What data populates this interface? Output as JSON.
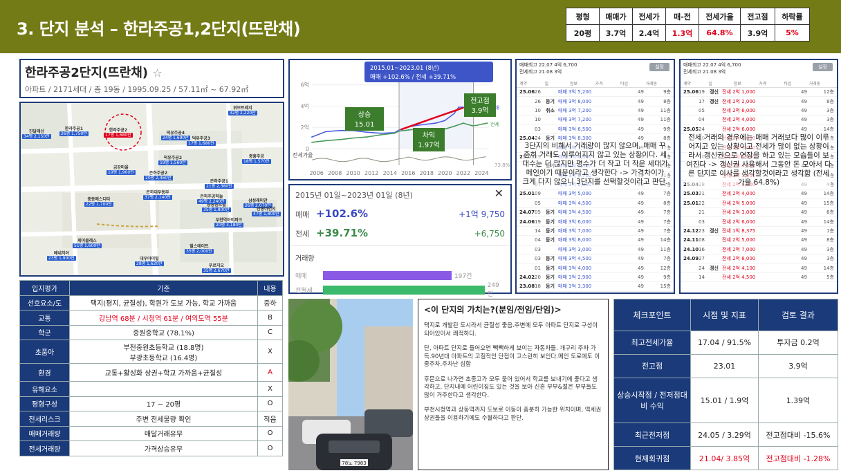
{
  "header": {
    "title": "3. 단지 분석 – 한라주공1,2단지(뜨란채)",
    "summary_headers": [
      "평형",
      "매매가",
      "전세가",
      "매-전",
      "전세가율",
      "전고점",
      "하락률"
    ],
    "summary_values": [
      "20평",
      "3.7억",
      "2.4억",
      "1.3억",
      "64.8%",
      "3.9억",
      "5%"
    ]
  },
  "complex": {
    "name": "한라주공2단지(뜨란채)",
    "star": "☆",
    "meta": "아파트 / 2171세대 / 총 19동 / 1995.09.25 / 57.11㎡ ~ 67.92㎡"
  },
  "map": {
    "labels": [
      {
        "name": "한라주공1",
        "sub": "26평 1,750만"
      },
      {
        "name": "한라주공2",
        "sub": "17평 1,680만"
      },
      {
        "name": "덕유주공4",
        "sub": "24평 1,690만"
      },
      {
        "name": "덕유주공3",
        "sub": "17평 1,680만"
      },
      {
        "name": "덕유주공2",
        "sub": "19평 1,560만"
      },
      {
        "name": "금강마을",
        "sub": "19평 1,900만"
      },
      {
        "name": "은하주공2",
        "sub": "20평 2,460만"
      },
      {
        "name": "은하주공1",
        "sub": "21평 2,380만"
      },
      {
        "name": "중동센트럴",
        "sub": "35평 1,800만"
      },
      {
        "name": "은하대우동부",
        "sub": "37평 2,140만"
      },
      {
        "name": "은하주공하늘",
        "sub": "49평 2,240만"
      },
      {
        "name": "중동에스디타",
        "sub": "22평 1,700만"
      },
      {
        "name": "진달래선",
        "sub": "34평 2,150만"
      },
      {
        "name": "위브트레지",
        "sub": "32평 2,220만"
      },
      {
        "name": "부천역아이파크",
        "sub": "20평 3,180만"
      },
      {
        "name": "삼성래미안",
        "sub": "26평 2,070만"
      },
      {
        "name": "제이클레스",
        "sub": "51평 1,600만"
      },
      {
        "name": "베네치아",
        "sub": "23평 1,900만"
      },
      {
        "name": "대우아이빌",
        "sub": "28평 1,620만"
      },
      {
        "name": "힐스테이트",
        "sub": "35평 2,000만"
      },
      {
        "name": "푸르지오",
        "sub": "35평 2,670만"
      },
      {
        "name": "산동아연서",
        "sub": "47평 1,800만"
      },
      {
        "name": "중흥주공",
        "sub": "18평 1,570만"
      }
    ]
  },
  "eval": {
    "headers": [
      "입지평가",
      "기준",
      "내용"
    ],
    "rows": [
      {
        "k": "선호요소/도",
        "v": "택지(평지, 균질성), 학원가 도보 가능, 학교 가까움",
        "r": "중하"
      },
      {
        "k": "교통",
        "v": "강남역 68분 / 시청역 61분 / 여의도역 55분",
        "r": "B"
      },
      {
        "k": "학군",
        "v": "중원중학교 (78.1%)",
        "r": "C"
      },
      {
        "k": "초품아",
        "v": "부천중원초등학교 (18.8명)",
        "v2": "부광초등학교 (16.4명)",
        "r": "X"
      },
      {
        "k": "환경",
        "v": "교통+활성화 상권+학교 가까움+균질성",
        "r": "A"
      },
      {
        "k": "유해요소",
        "v": "",
        "r": "X"
      },
      {
        "k": "평형구성",
        "v": "17 ~ 20평",
        "r": "O"
      },
      {
        "k": "전세리스크",
        "v": "주변 전세물량 확인",
        "r": "적음"
      },
      {
        "k": "매매거래량",
        "v": "매달거래유무",
        "r": "O"
      },
      {
        "k": "전세거래량",
        "v": "가격상승유무",
        "r": "O"
      }
    ]
  },
  "chart_data": {
    "type": "line",
    "title": "2015.01~2023.01 (8년)",
    "subtitle": "매매 +102.6% / 전세 +39.71%",
    "x_ticks": [
      "2006",
      "2008",
      "2010",
      "2012",
      "2014",
      "2016",
      "2018",
      "2020",
      "2022",
      "2024"
    ],
    "y_ticks": [
      "0",
      "2억",
      "4억",
      "6억"
    ],
    "ylim": [
      0,
      6.5
    ],
    "series": [
      {
        "name": "매매",
        "x": [
          2005.5,
          2007,
          2008.5,
          2010,
          2011.5,
          2013,
          2014.5,
          2015,
          2016,
          2017,
          2018,
          2019,
          2020,
          2021,
          2021.5,
          2022,
          2022.5,
          2023,
          2023.5,
          2024,
          2024.6
        ],
        "values": [
          1.1,
          1.6,
          1.7,
          1.7,
          1.55,
          1.45,
          1.5,
          1.75,
          2.05,
          2.2,
          2.3,
          2.4,
          2.65,
          3.3,
          3.9,
          3.9,
          3.55,
          3.3,
          3.4,
          3.5,
          3.7
        ],
        "color": "#4a5fe0"
      },
      {
        "name": "전세",
        "x": [
          2005.5,
          2007,
          2008.5,
          2010,
          2011.5,
          2013,
          2014.5,
          2015,
          2016,
          2017,
          2018,
          2019,
          2020,
          2021,
          2022,
          2023,
          2023.5,
          2024,
          2024.6
        ],
        "values": [
          0.6,
          0.75,
          0.85,
          1.0,
          1.1,
          1.3,
          1.45,
          1.65,
          1.75,
          1.85,
          1.8,
          1.75,
          1.85,
          2.1,
          2.4,
          2.15,
          2.2,
          2.3,
          2.4
        ],
        "color": "#4a9a5a"
      }
    ],
    "ratio_label": "전세가율",
    "ratio_value": "73.8%",
    "legend_deal": "매매",
    "legend_rent": "전세",
    "annotations": [
      {
        "text": "상승",
        "sub": "15.01"
      },
      {
        "text": "차익",
        "sub": "1.97억"
      },
      {
        "text": "전고점",
        "sub": "3.9억"
      }
    ]
  },
  "stats": {
    "date": "2015년 01일~2023년 01일 (8년)",
    "close": "✕",
    "deal_label": "매매",
    "deal_pct": "+102.6%",
    "deal_amt": "+1억 9,750",
    "rent_label": "전세",
    "rent_pct": "+39.71%",
    "rent_amt": "+6,750",
    "volume_label": "거래량",
    "vol_deal_label": "매매",
    "vol_deal_value": "197건",
    "vol_deal_count": 197,
    "vol_rent_label": "전월세",
    "vol_rent_value": "249건",
    "vol_rent_count": 249
  },
  "listing_a": {
    "line1": "매매최고 22.07 4억 6,700",
    "line2": "전세최고 21.08 3억",
    "badge": "설정",
    "cols": [
      "계약",
      "일",
      "정보",
      "가격",
      "타입",
      "거래동"
    ],
    "rows": [
      {
        "d": "25.06",
        "f": "26",
        "t": "",
        "p": "매매 3억 5,200",
        "s": "49",
        "n": "9층"
      },
      {
        "d": "",
        "f": "26",
        "t": "등기",
        "p": "매매 3억 8,000",
        "s": "49",
        "n": "8층"
      },
      {
        "d": "",
        "f": "10",
        "t": "취소",
        "p": "매매 3억 7,200",
        "s": "49",
        "n": "11층"
      },
      {
        "d": "",
        "f": "10",
        "t": "",
        "p": "매매 3억 7,200",
        "s": "49",
        "n": "11층"
      },
      {
        "d": "",
        "f": "03",
        "t": "",
        "p": "매매 3억 6,500",
        "s": "49",
        "n": "9층"
      },
      {
        "d": "25.04",
        "f": "24",
        "t": "등기",
        "p": "매매 3억 8,300",
        "s": "49",
        "n": "8층"
      },
      {
        "d": "",
        "f": "17",
        "t": "",
        "p": "매매 3억 7,500",
        "s": "49",
        "n": "7층"
      },
      {
        "d": "25.03",
        "f": "29",
        "t": "",
        "p": "매매 3억 8,800",
        "s": "49",
        "n": "9층"
      },
      {
        "d": "",
        "f": "22",
        "t": "등기",
        "p": "매매 3억 7,800",
        "s": "49",
        "n": "11층"
      },
      {
        "d": "",
        "f": "14",
        "t": "",
        "p": "매매 3억 6,700",
        "s": "49",
        "n": "11층"
      },
      {
        "d": "",
        "f": "07",
        "t": "",
        "p": "매매 3억 6,000",
        "s": "49",
        "n": "10층"
      },
      {
        "d": "25.01",
        "f": "09",
        "t": "",
        "p": "매매 3억 5,000",
        "s": "49",
        "n": "7층"
      },
      {
        "d": "",
        "f": "05",
        "t": "",
        "p": "매매 3억 4,500",
        "s": "49",
        "n": "8층"
      },
      {
        "d": "24.07",
        "f": "05",
        "t": "등기",
        "p": "매매 3억 4,500",
        "s": "49",
        "n": "7층"
      },
      {
        "d": "24.06",
        "f": "19",
        "t": "등기",
        "p": "매매 3억 6,000",
        "s": "49",
        "n": "7층"
      },
      {
        "d": "",
        "f": "14",
        "t": "등기",
        "p": "매매 3억 7,000",
        "s": "49",
        "n": "7층"
      },
      {
        "d": "",
        "f": "04",
        "t": "등기",
        "p": "매매 3억 8,000",
        "s": "49",
        "n": "14층"
      },
      {
        "d": "",
        "f": "03",
        "t": "",
        "p": "매매 3억 3,000",
        "s": "49",
        "n": "11층"
      },
      {
        "d": "",
        "f": "03",
        "t": "등기",
        "p": "매매 3억 4,500",
        "s": "49",
        "n": "7층"
      },
      {
        "d": "",
        "f": "01",
        "t": "등기",
        "p": "매매 3억 4,000",
        "s": "49",
        "n": "12층"
      },
      {
        "d": "24.02",
        "f": "20",
        "t": "등기",
        "p": "매매 3억 2,900",
        "s": "49",
        "n": "9층"
      },
      {
        "d": "23.08",
        "f": "18",
        "t": "등기",
        "p": "매매 3억 3,300",
        "s": "49",
        "n": "15층"
      }
    ],
    "overlay": "3단지의 비해서 거래량이 많지 않으며, 매매 꾸준히 거래도 이루어지지 않고 있는 상황이다. 세대수는 더 많지만 평수가 더 작고 더 작은 세대가 메인이기 때문이라고 생각한다 -> 가격차이가 크게 다지 않으니 3단지를 선택할것이라고 판단."
  },
  "listing_b": {
    "line1": "매매최고 22.07 4억 6,700",
    "line2": "전세최고 21.08 3억",
    "badge": "설정",
    "cols": [
      "계약",
      "일",
      "정보",
      "가격",
      "타입",
      "거래동"
    ],
    "rows": [
      {
        "d": "25.06",
        "f": "19",
        "t": "갱신",
        "p": "전세 2억 1,000",
        "s": "49",
        "n": "12층"
      },
      {
        "d": "",
        "f": "17",
        "t": "갱신",
        "p": "전세 2억 2,000",
        "s": "49",
        "n": "8층"
      },
      {
        "d": "",
        "f": "05",
        "t": "",
        "p": "전세 2억 6,000",
        "s": "49",
        "n": "3층"
      },
      {
        "d": "",
        "f": "04",
        "t": "",
        "p": "전세 2억 4,000",
        "s": "49",
        "n": "3층"
      },
      {
        "d": "25.05",
        "f": "24",
        "t": "",
        "p": "전세 2억 6,000",
        "s": "49",
        "n": "14층"
      },
      {
        "d": "",
        "f": "20",
        "t": "",
        "p": "전세 2억 5,000",
        "s": "49",
        "n": "2층"
      },
      {
        "d": "",
        "f": "13",
        "t": "",
        "p": "전세 2억 3,000",
        "s": "49",
        "n": "5층"
      },
      {
        "d": "",
        "f": "10",
        "t": "",
        "p": "전세 2억 6,000",
        "s": "49",
        "n": "11층"
      },
      {
        "d": "",
        "f": "07",
        "t": "",
        "p": "전세 2억 4,500",
        "s": "49",
        "n": "7층"
      },
      {
        "d": "",
        "f": "03",
        "t": "",
        "p": "전세 2억 5,000",
        "s": "49",
        "n": "9층"
      },
      {
        "d": "25.04",
        "f": "28",
        "t": "",
        "p": "전세 2억 6,000",
        "s": "49",
        "n": "4층"
      },
      {
        "d": "25.03",
        "f": "21",
        "t": "",
        "p": "전세 2억 4,000",
        "s": "49",
        "n": "14층"
      },
      {
        "d": "25.01",
        "f": "22",
        "t": "",
        "p": "전세 2억 5,000",
        "s": "49",
        "n": "15층"
      },
      {
        "d": "",
        "f": "21",
        "t": "",
        "p": "전세 2억 3,000",
        "s": "49",
        "n": "6층"
      },
      {
        "d": "",
        "f": "03",
        "t": "",
        "p": "전세 2억 6,000",
        "s": "49",
        "n": "14층"
      },
      {
        "d": "24.12",
        "f": "23",
        "t": "갱신",
        "p": "전세 1억 8,375",
        "s": "49",
        "n": "1층"
      },
      {
        "d": "24.11",
        "f": "08",
        "t": "",
        "p": "전세 2억 5,000",
        "s": "49",
        "n": "8층"
      },
      {
        "d": "24.10",
        "f": "16",
        "t": "",
        "p": "전세 2억 7,000",
        "s": "49",
        "n": "3층"
      },
      {
        "d": "24.09",
        "f": "27",
        "t": "",
        "p": "전세 2억 8,000",
        "s": "49",
        "n": "3층"
      },
      {
        "d": "",
        "f": "24",
        "t": "갱신",
        "p": "전세 2억 4,100",
        "s": "49",
        "n": "14층"
      },
      {
        "d": "",
        "f": "14",
        "t": "",
        "p": "전세 2억 4,500",
        "s": "49",
        "n": "5층"
      }
    ],
    "overlay": "전세 거래의 경우에는 매매 거래보다 많이 이루어지고 있는 상황이고 전세가 많이 없는 상황이라서 갱신권으로 연장을 하고 있는 모습들이 보여진다 -> 갱신권 사용해서 그동안 돈 모아서 다른 단지로 이사를 생각할것이라고 생각함 (전세가율 64.8%)"
  },
  "photo": {
    "plate": "78노 7983"
  },
  "value": {
    "title": "<이 단지의 가치는?(분임/전임/단임)>",
    "p1": "택지로 개발된 도시라서 균질성 좋음.주변에 모두 아파트 단지로 구성이 되어있어서 쾌적하다.",
    "p2": "단, 아파트 단지로 들어오면 빽빽하게 보이는 자동차들. 개구리 주차 가득.90년대 아파트의 고질적인 단점이 고스란히 보인다.메인 도로에도 이중주차.주차난 심함",
    "p3": "후문으로 나가면 초중고가 모두 붙어 있어서 학교를 보내기에 좋다고 생각하고, 단지내에 어린이집도 있는 것을 보아 신혼 부부&젊은 부부들도 많이 거주한다고 생각한다.",
    "p4": "부천시청역과 상동역까지 도보로 이동이 충분히 가능한 위치이며, 역세권 상권들을 이용하기에도 수월하다고 판단."
  },
  "check": {
    "headers": [
      "체크포인트",
      "시점 및 지표",
      "검토 결과"
    ],
    "rows": [
      {
        "k": "최고전세가율",
        "a": "17.04 / 91.5%",
        "b": "투자금 0.2억"
      },
      {
        "k": "전고점",
        "a": "23.01",
        "b": "3.9억"
      },
      {
        "k": "상승시작점 / 전저점대비 수익",
        "a": "15.01 / 1.9억",
        "b": "1.39억"
      },
      {
        "k": "최근전저점",
        "a": "24.05 / 3.29억",
        "b": "전고점대비 -15.6%"
      },
      {
        "k": "현재회귀점",
        "a": "21.04/ 3.85억",
        "b": "전고점대비 -1.28%"
      }
    ]
  },
  "colors": {
    "header_bg": "#737b16",
    "navy": "#1a3a7a",
    "alert_red": "#e0001b",
    "deal_blue": "#4a5fe0",
    "rent_green": "#4a9a5a",
    "vol_purple": "#8a5ae6",
    "vol_green": "#3aba6a"
  }
}
